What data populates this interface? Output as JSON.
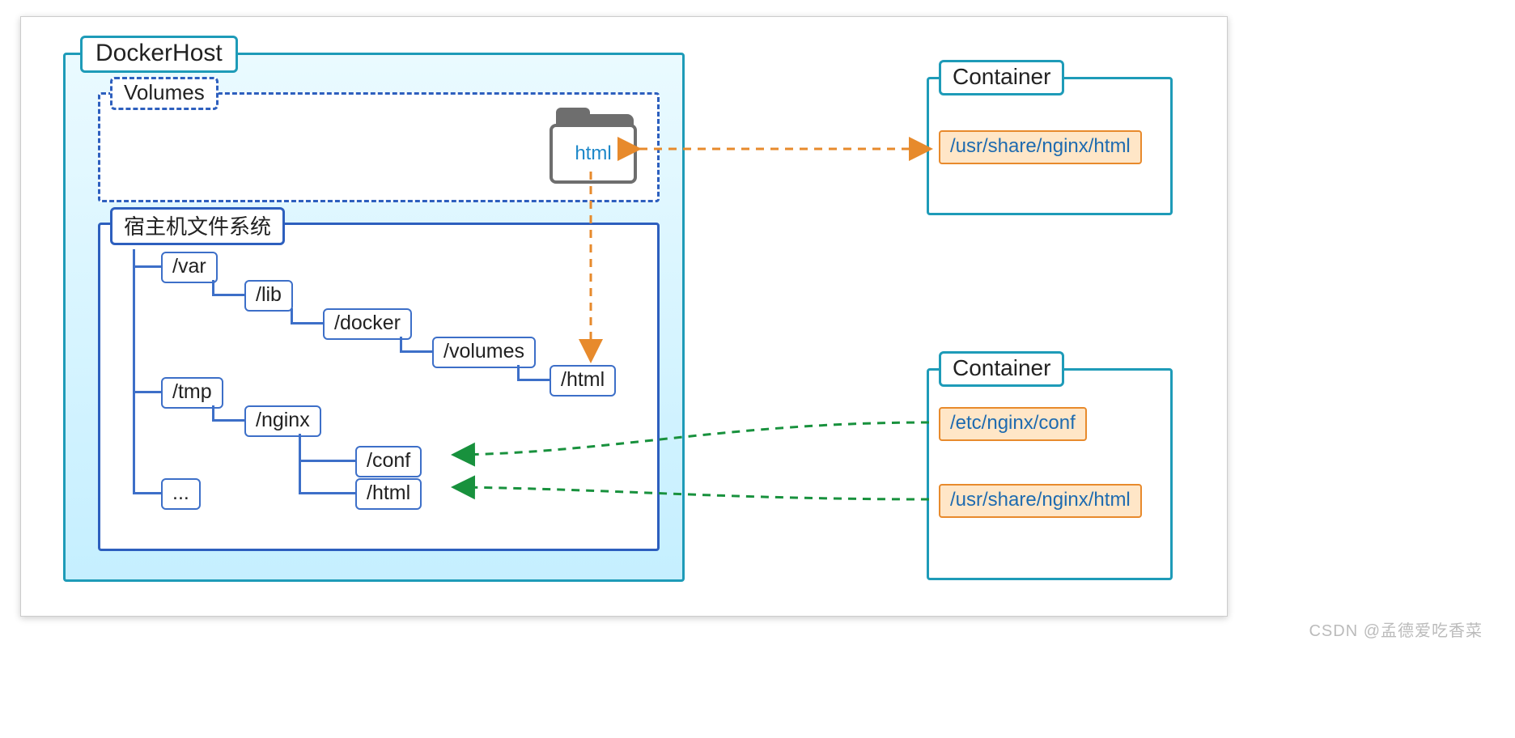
{
  "docker_host": {
    "label": "DockerHost",
    "volumes": {
      "label": "Volumes",
      "folder": "html"
    },
    "filesystem": {
      "label": "宿主机文件系统",
      "nodes": {
        "var": "/var",
        "lib": "/lib",
        "docker": "/docker",
        "volumes": "/volumes",
        "html_vol": "/html",
        "tmp": "/tmp",
        "nginx": "/nginx",
        "conf": "/conf",
        "html_tmp": "/html",
        "more": "..."
      }
    }
  },
  "containers": [
    {
      "label": "Container",
      "paths": [
        "/usr/share/nginx/html"
      ]
    },
    {
      "label": "Container",
      "paths": [
        "/etc/nginx/conf",
        "/usr/share/nginx/html"
      ]
    }
  ],
  "watermark": "CSDN @孟德爱吃香菜"
}
